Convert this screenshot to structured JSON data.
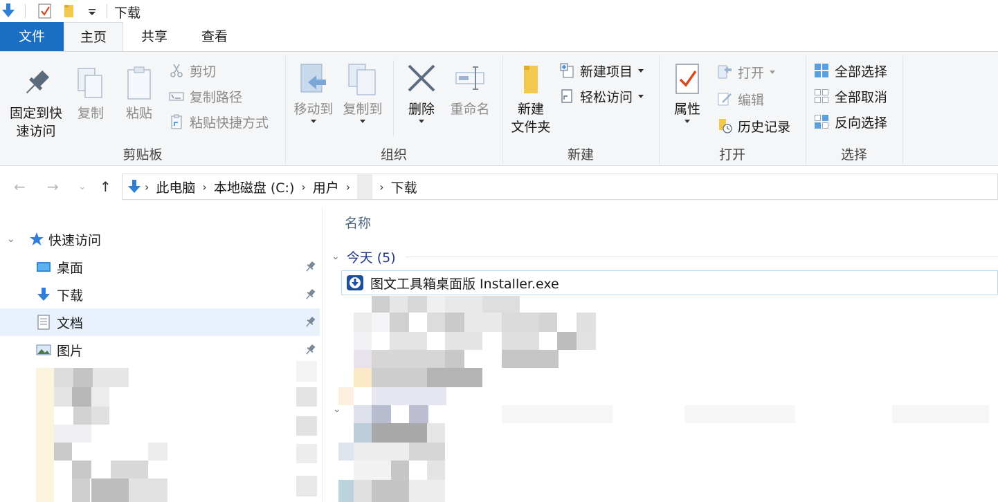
{
  "titlebar": {
    "title": "下载",
    "qa_icons": [
      "download-arrow-icon",
      "properties-check-icon",
      "folder-icon",
      "customize-dropdown-icon"
    ]
  },
  "tabs": {
    "file": "文件",
    "home": "主页",
    "share": "共享",
    "view": "查看"
  },
  "ribbon": {
    "clipboard": {
      "label": "剪贴板",
      "pin_line1": "固定到快",
      "pin_line2": "速访问",
      "copy": "复制",
      "paste": "粘贴",
      "cut": "剪切",
      "copy_path": "复制路径",
      "paste_shortcut": "粘贴快捷方式"
    },
    "organize": {
      "label": "组织",
      "move_to": "移动到",
      "copy_to": "复制到",
      "delete": "删除",
      "rename": "重命名"
    },
    "new": {
      "label": "新建",
      "new_folder_line1": "新建",
      "new_folder_line2": "文件夹",
      "new_item": "新建项目",
      "easy_access": "轻松访问"
    },
    "open": {
      "label": "打开",
      "properties": "属性",
      "open": "打开",
      "edit": "编辑",
      "history": "历史记录"
    },
    "select": {
      "label": "选择",
      "select_all": "全部选择",
      "select_none": "全部取消",
      "invert": "反向选择"
    }
  },
  "address": {
    "crumbs": [
      "此电脑",
      "本地磁盘 (C:)",
      "用户",
      "下载"
    ]
  },
  "navpane": {
    "quick_access": "快速访问",
    "items": [
      {
        "label": "桌面",
        "icon": "desktop-icon"
      },
      {
        "label": "下载",
        "icon": "downloads-icon"
      },
      {
        "label": "文档",
        "icon": "documents-icon"
      },
      {
        "label": "图片",
        "icon": "pictures-icon"
      }
    ]
  },
  "content": {
    "column_name": "名称",
    "group_today": "今天 (5)",
    "files": [
      {
        "name": "图文工具箱桌面版 Installer.exe",
        "icon": "installer-icon"
      }
    ]
  },
  "colors": {
    "file_tab": "#1a6fc4",
    "ribbon_bg": "#f5f6f7",
    "selected_nav": "#e9f2fc",
    "group_header": "#1e3287"
  }
}
